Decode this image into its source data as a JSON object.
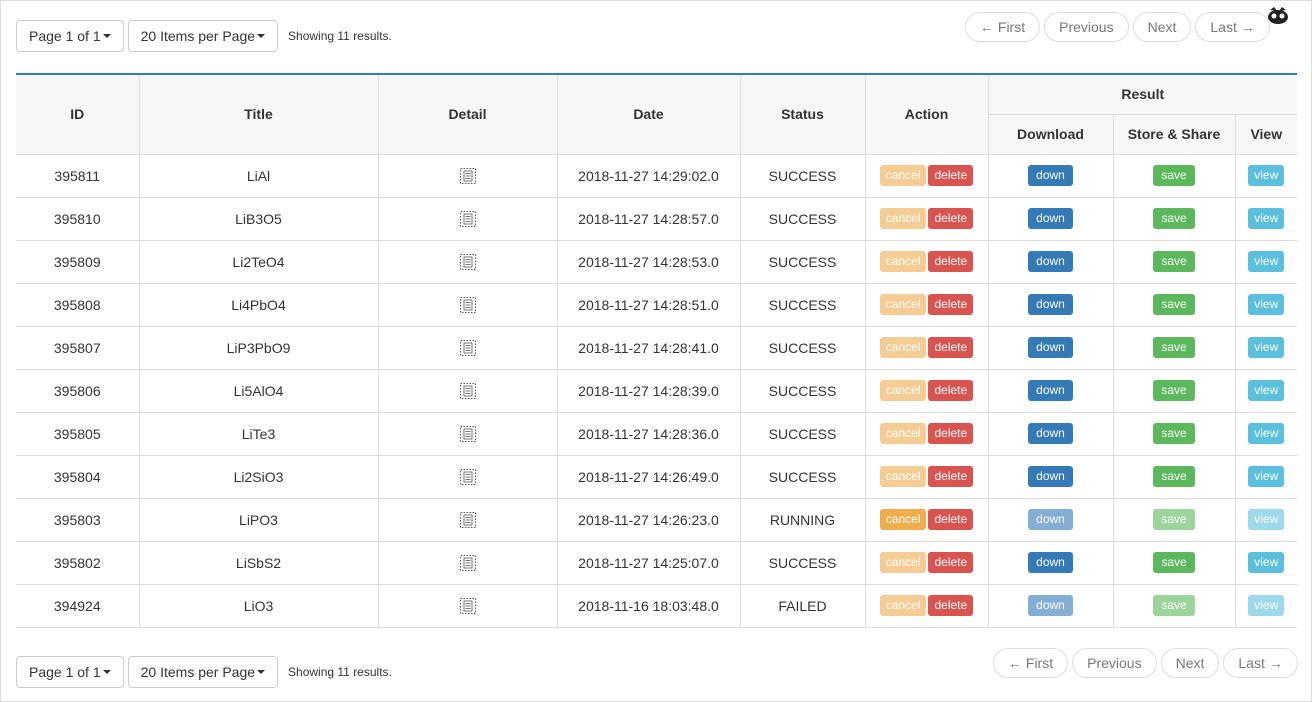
{
  "pagination": {
    "page_label": "Page 1 of 1",
    "per_page_label": "20 Items per Page",
    "showing": "Showing 11 results.",
    "first": "← First",
    "previous": "Previous",
    "next": "Next",
    "last": "Last →"
  },
  "table": {
    "headers": {
      "id": "ID",
      "title": "Title",
      "detail": "Detail",
      "date": "Date",
      "status": "Status",
      "action": "Action",
      "result": "Result",
      "download": "Download",
      "store_share": "Store & Share",
      "view": "View"
    },
    "buttons": {
      "cancel": "cancel",
      "delete": "delete",
      "down": "down",
      "save": "save",
      "view": "view"
    },
    "rows": [
      {
        "id": "395811",
        "title": "LiAl",
        "date": "2018-11-27 14:29:02.0",
        "status": "SUCCESS"
      },
      {
        "id": "395810",
        "title": "LiB3O5",
        "date": "2018-11-27 14:28:57.0",
        "status": "SUCCESS"
      },
      {
        "id": "395809",
        "title": "Li2TeO4",
        "date": "2018-11-27 14:28:53.0",
        "status": "SUCCESS"
      },
      {
        "id": "395808",
        "title": "Li4PbO4",
        "date": "2018-11-27 14:28:51.0",
        "status": "SUCCESS"
      },
      {
        "id": "395807",
        "title": "LiP3PbO9",
        "date": "2018-11-27 14:28:41.0",
        "status": "SUCCESS"
      },
      {
        "id": "395806",
        "title": "Li5AlO4",
        "date": "2018-11-27 14:28:39.0",
        "status": "SUCCESS"
      },
      {
        "id": "395805",
        "title": "LiTe3",
        "date": "2018-11-27 14:28:36.0",
        "status": "SUCCESS"
      },
      {
        "id": "395804",
        "title": "Li2SiO3",
        "date": "2018-11-27 14:26:49.0",
        "status": "SUCCESS"
      },
      {
        "id": "395803",
        "title": "LiPO3",
        "date": "2018-11-27 14:26:23.0",
        "status": "RUNNING"
      },
      {
        "id": "395802",
        "title": "LiSbS2",
        "date": "2018-11-27 14:25:07.0",
        "status": "SUCCESS"
      },
      {
        "id": "394924",
        "title": "LiO3",
        "date": "2018-11-16 18:03:48.0",
        "status": "FAILED"
      }
    ]
  },
  "icons": {
    "detail": "document-icon",
    "logo": "logo-icon"
  },
  "colors": {
    "accent": "#337ab7",
    "cancel": "#f0ad4e",
    "delete": "#d9534f",
    "save": "#5cb85c",
    "view": "#5bc0de"
  }
}
